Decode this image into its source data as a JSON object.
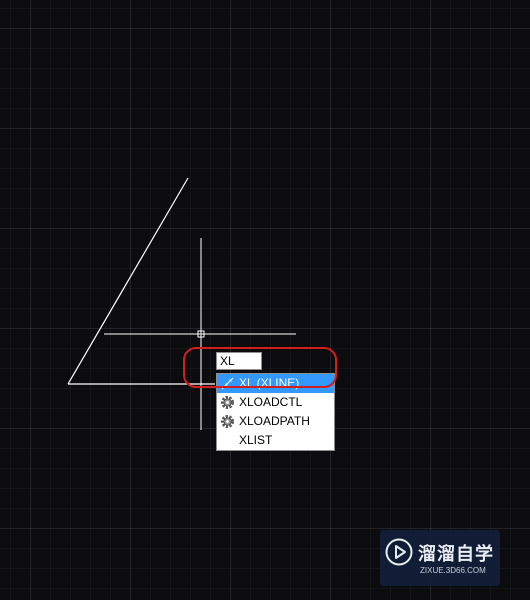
{
  "command_line": {
    "input_value": "XL"
  },
  "autocomplete": {
    "items": [
      {
        "label": "XL (XLINE)",
        "icon": "xline-icon",
        "selected": true
      },
      {
        "label": "XLOADCTL",
        "icon": "gear-icon",
        "selected": false
      },
      {
        "label": "XLOADPATH",
        "icon": "gear-icon",
        "selected": false
      },
      {
        "label": "XLIST",
        "icon": "none",
        "selected": false
      }
    ]
  },
  "watermark": {
    "title": "溜溜自学",
    "url": "ZIXUE.3D66.COM"
  },
  "colors": {
    "canvas_bg": "#0c0c0e",
    "selection": "#3399ff",
    "highlight": "#d21e1e",
    "geometry": "#ffffff"
  }
}
